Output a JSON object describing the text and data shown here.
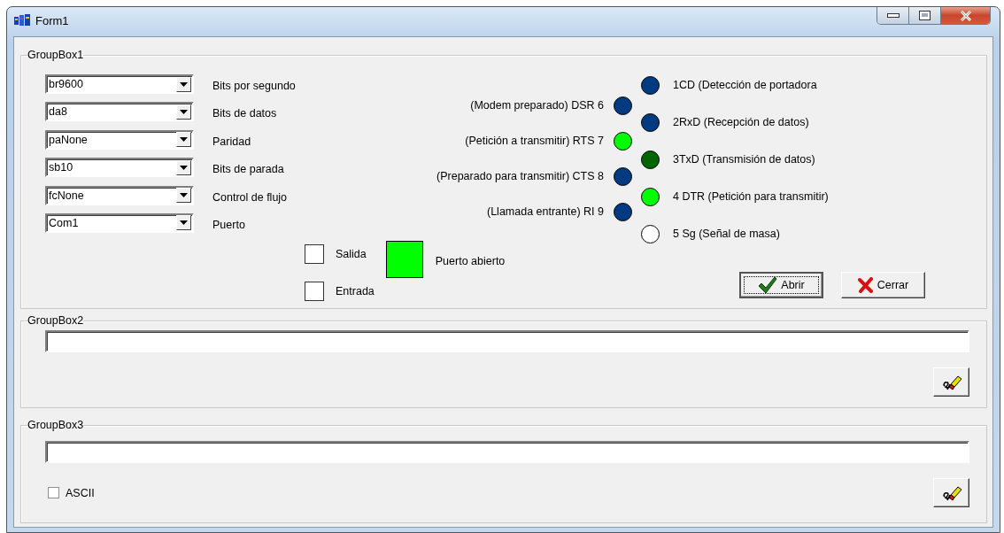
{
  "window": {
    "title": "Form1"
  },
  "groupbox1": {
    "title": "GroupBox1",
    "settings": [
      {
        "value": "br9600",
        "label": "Bits por segundo"
      },
      {
        "value": "da8",
        "label": "Bits de datos"
      },
      {
        "value": "paNone",
        "label": "Paridad"
      },
      {
        "value": "sb10",
        "label": "Bits de parada"
      },
      {
        "value": "fcNone",
        "label": "Control de flujo"
      },
      {
        "value": "Com1",
        "label": "Puerto"
      }
    ],
    "signals_left": [
      {
        "label": "(Modem preparado) DSR 6",
        "color": "#003a80"
      },
      {
        "label": "(Petición a transmitir) RTS 7",
        "color": "#00ff00"
      },
      {
        "label": "(Preparado para transmitir) CTS 8",
        "color": "#003a80"
      },
      {
        "label": "(Llamada entrante) RI 9",
        "color": "#003a80"
      }
    ],
    "signals_right": [
      {
        "label": "1CD (Detección de portadora",
        "color": "#003a80"
      },
      {
        "label": "2RxD (Recepción de datos)",
        "color": "#003a80"
      },
      {
        "label": "3TxD (Transmisión de datos)",
        "color": "#006400"
      },
      {
        "label": "4 DTR (Petición para transmitir)",
        "color": "#00ff00"
      },
      {
        "label": "5 Sg (Señal de masa)",
        "color": "#ffffff"
      }
    ],
    "checkboxes": [
      {
        "label": "Salida",
        "checked": false
      },
      {
        "label": "Entrada",
        "checked": false
      }
    ],
    "port_indicator": {
      "label": "Puerto abierto",
      "on": true
    },
    "buttons": [
      {
        "label": "Abrir",
        "kind": "open",
        "focused": true
      },
      {
        "label": "Cerrar",
        "kind": "close",
        "focused": false
      }
    ]
  },
  "groupbox2": {
    "title": "GroupBox2"
  },
  "groupbox3": {
    "title": "GroupBox3",
    "checkbox": {
      "label": "ASCII",
      "checked": false
    }
  }
}
